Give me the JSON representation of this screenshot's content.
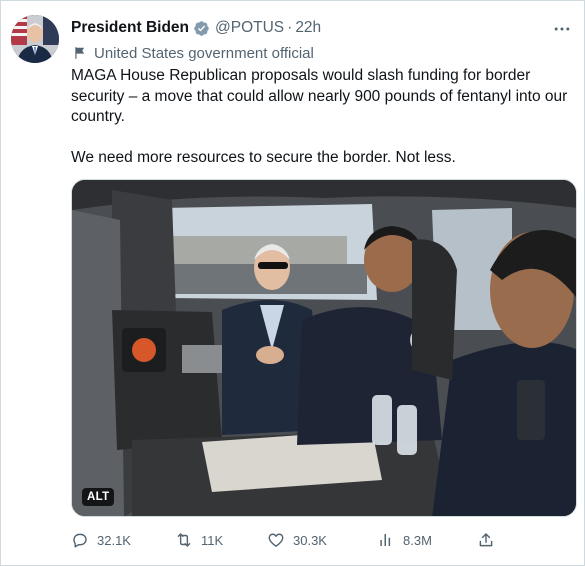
{
  "tweet": {
    "author": {
      "display_name": "President Biden",
      "handle": "@POTUS",
      "separator": "·",
      "time": "22h",
      "verified": true,
      "verified_color": "#829aab",
      "avatar_icon": "avatar-photo"
    },
    "affiliation": {
      "icon": "flag-icon",
      "label": "United States government official"
    },
    "text": {
      "line1": "MAGA House Republican proposals would slash funding for border security – a move that could allow nearly 900 pounds of fentanyl into our country.",
      "line2": "We need more resources to secure the border. Not less."
    },
    "media": {
      "alt_badge": "ALT"
    },
    "actions": {
      "replies": "32.1K",
      "retweets": "11K",
      "likes": "30.3K",
      "views": "8.3M"
    },
    "colors": {
      "text_primary": "#0f1419",
      "text_secondary": "#536471",
      "border": "#cfd9de"
    }
  }
}
